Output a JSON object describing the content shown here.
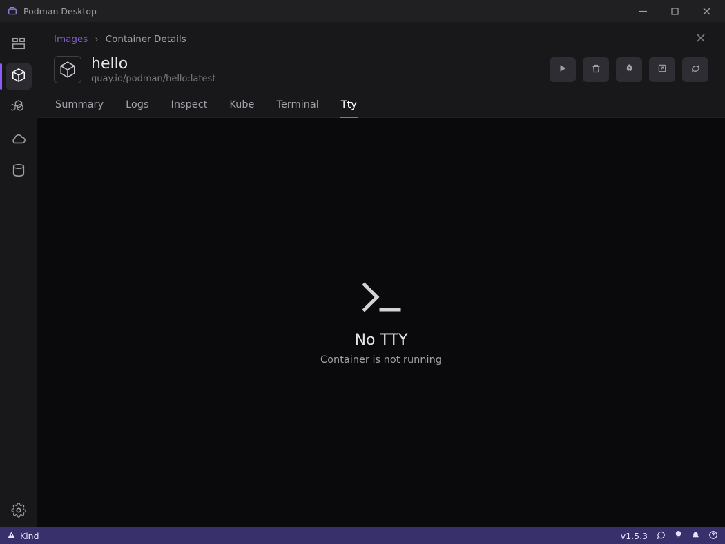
{
  "app": {
    "title": "Podman Desktop"
  },
  "breadcrumb": {
    "root": "Images",
    "current": "Container Details"
  },
  "container": {
    "name": "hello",
    "image_ref": "quay.io/podman/hello:latest"
  },
  "tabs": {
    "summary": "Summary",
    "logs": "Logs",
    "inspect": "Inspect",
    "kube": "Kube",
    "terminal": "Terminal",
    "tty": "Tty",
    "active": "tty"
  },
  "empty_state": {
    "title": "No TTY",
    "message": "Container is not running"
  },
  "statusbar": {
    "context": "Kind",
    "version": "v1.5.3"
  }
}
